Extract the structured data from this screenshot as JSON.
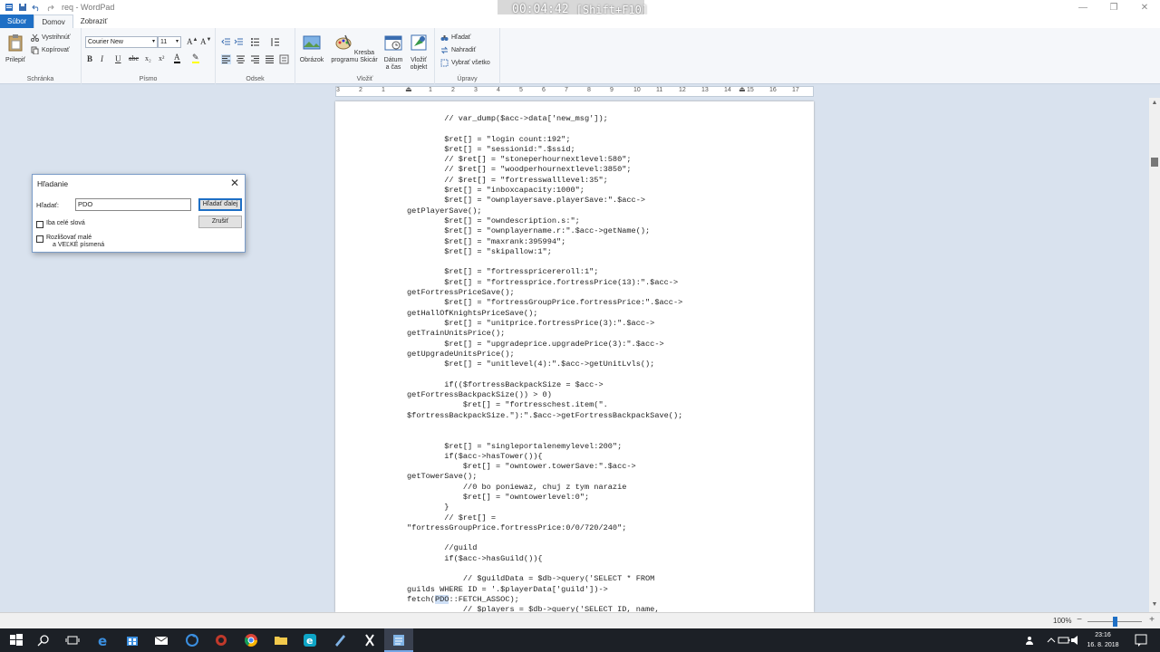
{
  "window": {
    "title": "req - WordPad",
    "controls": [
      "—",
      "❐",
      "✕"
    ]
  },
  "recorder": {
    "time": "00:04:42",
    "shortcut": "[Shift+F10]"
  },
  "tabs": [
    "Súbor",
    "Domov",
    "Zobraziť"
  ],
  "ribbon": {
    "clipboard": {
      "label": "Schránka",
      "paste": "Prilepiť",
      "cut": "Vystrihnúť",
      "copy": "Kopírovať"
    },
    "font": {
      "label": "Písmo",
      "family": "Courier New",
      "size": "11"
    },
    "paragraph": {
      "label": "Odsek"
    },
    "insert": {
      "label": "Vložiť",
      "picture": "Obrázok",
      "paint_line1": "Kresba",
      "paint_line2": "programu Skicár",
      "datetime_line1": "Dátum",
      "datetime_line2": "a čas",
      "object_line1": "Vložiť",
      "object_line2": "objekt"
    },
    "editing": {
      "label": "Úpravy",
      "find": "Hľadať",
      "replace": "Nahradiť",
      "select_all": "Vybrať všetko"
    }
  },
  "ruler": {
    "numbers": [
      "3",
      "2",
      "1",
      "1",
      "2",
      "3",
      "4",
      "5",
      "6",
      "7",
      "8",
      "9",
      "10",
      "11",
      "12",
      "13",
      "14",
      "15",
      "16",
      "17"
    ]
  },
  "document": {
    "lines": [
      "        // var_dump($acc->data['new_msg']);",
      "",
      "        $ret[] = \"login count:192\";",
      "        $ret[] = \"sessionid:\".$ssid;",
      "        // $ret[] = \"stoneperhournextlevel:580\";",
      "        // $ret[] = \"woodperhournextlevel:3850\";",
      "        // $ret[] = \"fortresswalllevel:35\";",
      "        $ret[] = \"inboxcapacity:1000\";",
      "        $ret[] = \"ownplayersave.playerSave:\".$acc->",
      "getPlayerSave();",
      "        $ret[] = \"owndescription.s:\";",
      "        $ret[] = \"ownplayername.r:\".$acc->getName();",
      "        $ret[] = \"maxrank:395994\";",
      "        $ret[] = \"skipallow:1\";",
      "",
      "        $ret[] = \"fortresspricereroll:1\";",
      "        $ret[] = \"fortressprice.fortressPrice(13):\".$acc->",
      "getFortressPriceSave();",
      "        $ret[] = \"fortressGroupPrice.fortressPrice:\".$acc->",
      "getHallOfKnightsPriceSave();",
      "        $ret[] = \"unitprice.fortressPrice(3):\".$acc->",
      "getTrainUnitsPrice();",
      "        $ret[] = \"upgradeprice.upgradePrice(3):\".$acc->",
      "getUpgradeUnitsPrice();",
      "        $ret[] = \"unitlevel(4):\".$acc->getUnitLvls();",
      "",
      "        if(($fortressBackpackSize = $acc->",
      "getFortressBackpackSize()) > 0)",
      "            $ret[] = \"fortresschest.item(\".",
      "$fortressBackpackSize.\"):\".$acc->getFortressBackpackSave();",
      "",
      "",
      "        $ret[] = \"singleportalenemylevel:200\";",
      "        if($acc->hasTower()){",
      "            $ret[] = \"owntower.towerSave:\".$acc->",
      "getTowerSave();",
      "            //0 bo poniewaz, chuj z tym narazie",
      "            $ret[] = \"owntowerlevel:0\";",
      "        }",
      "        // $ret[] =",
      "\"fortressGroupPrice.fortressPrice:0/0/720/240\";",
      "",
      "        //guild",
      "        if($acc->hasGuild()){",
      "",
      "            // $guildData = $db->query('SELECT * FROM",
      "guilds WHERE ID = '.$playerData['guild'])->",
      "fetch(",
      "            // $players = $db->query('SELECT ID, name,"
    ],
    "highlight_line": {
      "before": "fetch(",
      "match": "PDO",
      "after": "::FETCH_ASSOC);"
    }
  },
  "status": {
    "zoom": "100%"
  },
  "find_dialog": {
    "title": "Hľadanie",
    "find_label": "Hľadať:",
    "find_value": "PDO",
    "find_next": "Hľadať ďalej",
    "cancel": "Zrušiť",
    "whole_word": "Iba celé slová",
    "match_case_line1": "Rozlišovať malé",
    "match_case_line2": "a VEĽKÉ písmená"
  },
  "taskbar": {
    "time": "23:16",
    "date": "16. 8. 2018"
  }
}
